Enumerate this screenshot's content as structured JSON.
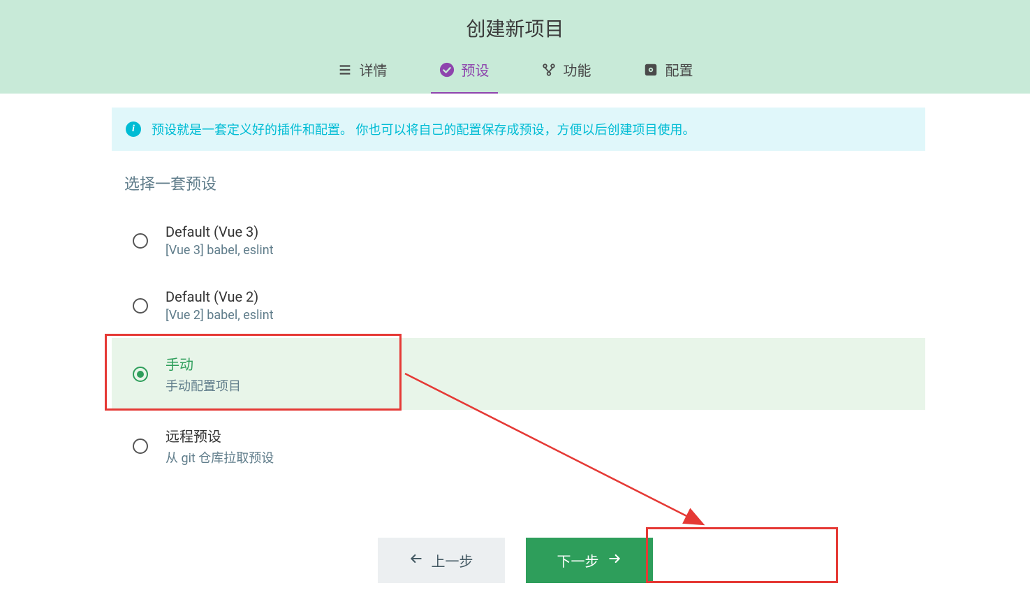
{
  "header": {
    "title": "创建新项目",
    "tabs": [
      {
        "label": "详情",
        "icon": "list-icon",
        "active": false
      },
      {
        "label": "预设",
        "icon": "check-circle-icon",
        "active": true
      },
      {
        "label": "功能",
        "icon": "merge-icon",
        "active": false
      },
      {
        "label": "配置",
        "icon": "gear-icon",
        "active": false
      }
    ]
  },
  "info_banner": "预设就是一套定义好的插件和配置。 你也可以将自己的配置保存成预设，方便以后创建项目使用。",
  "section_title": "选择一套预设",
  "presets": [
    {
      "title": "Default (Vue 3)",
      "desc": "[Vue 3] babel, eslint",
      "selected": false
    },
    {
      "title": "Default (Vue 2)",
      "desc": "[Vue 2] babel, eslint",
      "selected": false
    },
    {
      "title": "手动",
      "desc": "手动配置项目",
      "selected": true
    },
    {
      "title": "远程预设",
      "desc": "从 git 仓库拉取预设",
      "selected": false
    }
  ],
  "buttons": {
    "prev": "上一步",
    "next": "下一步"
  }
}
